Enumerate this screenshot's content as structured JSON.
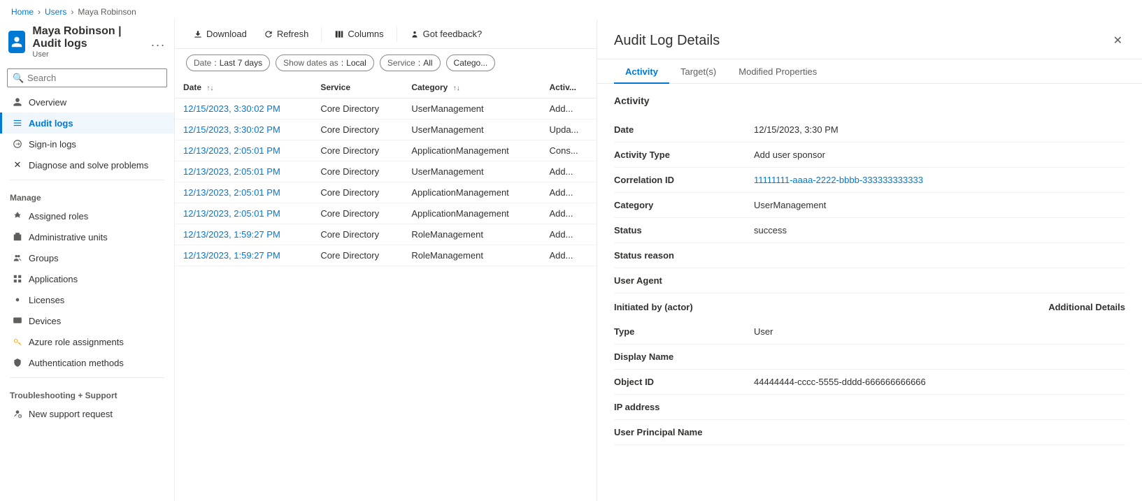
{
  "breadcrumb": {
    "items": [
      "Home",
      "Users",
      "Maya Robinson"
    ]
  },
  "sidebar": {
    "user_icon_label": "MR",
    "title": "Maya Robinson | Audit logs",
    "subtitle": "User",
    "more_label": "...",
    "search_placeholder": "Search",
    "collapse_icon": "«",
    "nav_items": [
      {
        "id": "overview",
        "label": "Overview",
        "icon": "person"
      },
      {
        "id": "audit-logs",
        "label": "Audit logs",
        "icon": "list",
        "active": true
      },
      {
        "id": "sign-in-logs",
        "label": "Sign-in logs",
        "icon": "signin"
      },
      {
        "id": "diagnose",
        "label": "Diagnose and solve problems",
        "icon": "wrench"
      }
    ],
    "manage_label": "Manage",
    "manage_items": [
      {
        "id": "assigned-roles",
        "label": "Assigned roles",
        "icon": "role"
      },
      {
        "id": "admin-units",
        "label": "Administrative units",
        "icon": "building"
      },
      {
        "id": "groups",
        "label": "Groups",
        "icon": "groups"
      },
      {
        "id": "applications",
        "label": "Applications",
        "icon": "apps"
      },
      {
        "id": "licenses",
        "label": "Licenses",
        "icon": "license"
      },
      {
        "id": "devices",
        "label": "Devices",
        "icon": "device"
      },
      {
        "id": "azure-roles",
        "label": "Azure role assignments",
        "icon": "key"
      },
      {
        "id": "auth-methods",
        "label": "Authentication methods",
        "icon": "shield"
      }
    ],
    "troubleshooting_label": "Troubleshooting + Support",
    "support_items": [
      {
        "id": "new-support",
        "label": "New support request",
        "icon": "person-support"
      }
    ]
  },
  "toolbar": {
    "download_label": "Download",
    "refresh_label": "Refresh",
    "columns_label": "Columns",
    "feedback_label": "Got feedback?"
  },
  "filters": {
    "date_label": "Date",
    "date_value": "Last 7 days",
    "show_dates_label": "Show dates as",
    "show_dates_value": "Local",
    "service_label": "Service",
    "service_value": "All",
    "category_label": "Catego..."
  },
  "table": {
    "columns": [
      {
        "id": "date",
        "label": "Date",
        "sortable": true
      },
      {
        "id": "service",
        "label": "Service",
        "sortable": false
      },
      {
        "id": "category",
        "label": "Category",
        "sortable": true
      },
      {
        "id": "activity",
        "label": "Activ...",
        "sortable": false
      }
    ],
    "rows": [
      {
        "date": "12/15/2023, 3:30:02 PM",
        "service": "Core Directory",
        "category": "UserManagement",
        "activity": "Add..."
      },
      {
        "date": "12/15/2023, 3:30:02 PM",
        "service": "Core Directory",
        "category": "UserManagement",
        "activity": "Upda..."
      },
      {
        "date": "12/13/2023, 2:05:01 PM",
        "service": "Core Directory",
        "category": "ApplicationManagement",
        "activity": "Cons..."
      },
      {
        "date": "12/13/2023, 2:05:01 PM",
        "service": "Core Directory",
        "category": "UserManagement",
        "activity": "Add..."
      },
      {
        "date": "12/13/2023, 2:05:01 PM",
        "service": "Core Directory",
        "category": "ApplicationManagement",
        "activity": "Add..."
      },
      {
        "date": "12/13/2023, 2:05:01 PM",
        "service": "Core Directory",
        "category": "ApplicationManagement",
        "activity": "Add..."
      },
      {
        "date": "12/13/2023, 1:59:27 PM",
        "service": "Core Directory",
        "category": "RoleManagement",
        "activity": "Add..."
      },
      {
        "date": "12/13/2023, 1:59:27 PM",
        "service": "Core Directory",
        "category": "RoleManagement",
        "activity": "Add..."
      }
    ]
  },
  "panel": {
    "title": "Audit Log Details",
    "close_label": "✕",
    "tabs": [
      {
        "id": "activity",
        "label": "Activity",
        "active": true
      },
      {
        "id": "targets",
        "label": "Target(s)"
      },
      {
        "id": "modified-properties",
        "label": "Modified Properties"
      }
    ],
    "section_title": "Activity",
    "details": [
      {
        "label": "Date",
        "value": "12/15/2023, 3:30 PM",
        "type": "text"
      },
      {
        "label": "Activity Type",
        "value": "Add user sponsor",
        "type": "text"
      },
      {
        "label": "Correlation ID",
        "value": "11111111-aaaa-2222-bbbb-333333333333",
        "type": "link"
      },
      {
        "label": "Category",
        "value": "UserManagement",
        "type": "text"
      },
      {
        "label": "Status",
        "value": "success",
        "type": "text"
      },
      {
        "label": "Status reason",
        "value": "",
        "type": "text"
      },
      {
        "label": "User Agent",
        "value": "",
        "type": "text"
      }
    ],
    "initiated_label": "Initiated by (actor)",
    "additional_details_label": "Additional Details",
    "actor_details": [
      {
        "label": "Type",
        "value": "User",
        "type": "text"
      },
      {
        "label": "Display Name",
        "value": "",
        "type": "text"
      },
      {
        "label": "Object ID",
        "value": "44444444-cccc-5555-dddd-666666666666",
        "type": "text"
      },
      {
        "label": "IP address",
        "value": "",
        "type": "text"
      },
      {
        "label": "User Principal Name",
        "value": "",
        "type": "text"
      }
    ]
  }
}
